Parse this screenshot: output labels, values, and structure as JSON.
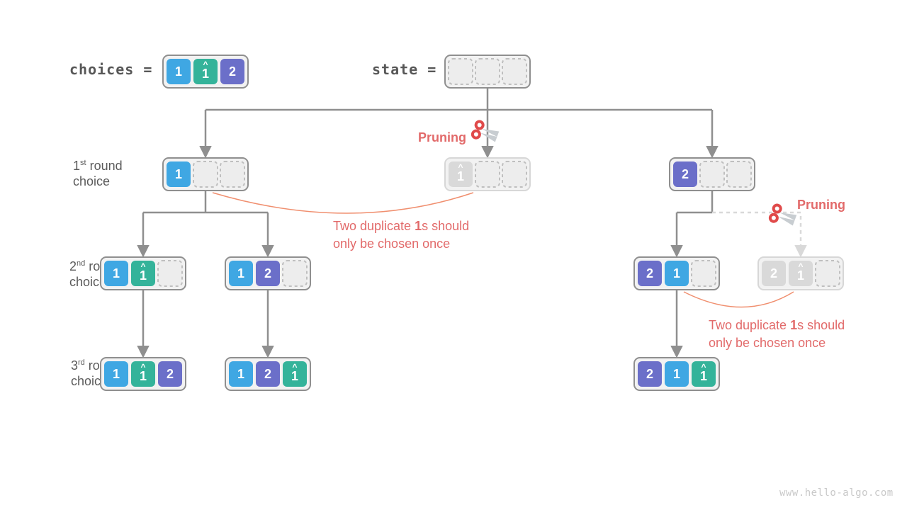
{
  "header": {
    "choices_label": "choices =",
    "state_label": "state ="
  },
  "rounds": {
    "r1_pre": "1",
    "r1_sup": "st",
    "r1_post": " round",
    "r2_pre": "2",
    "r2_sup": "nd",
    "r2_post": " round",
    "r3_pre": "3",
    "r3_sup": "rd",
    "r3_post": " round",
    "word_choice": "choice"
  },
  "values": {
    "one": "1",
    "onehat_caret": "^",
    "onehat": "1",
    "two": "2"
  },
  "annotations": {
    "pruning": "Pruning",
    "dup_line1": "Two duplicate ",
    "dup_bold": "1",
    "dup_line1b": "s should",
    "dup_line2": "only be chosen once"
  },
  "watermark": "www.hello-algo.com",
  "chart_data": {
    "type": "tree",
    "input_choices": [
      "1",
      "1̂",
      "2"
    ],
    "initial_state": [
      "_",
      "_",
      "_"
    ],
    "levels": [
      {
        "round": 1,
        "nodes": [
          {
            "state": [
              "1",
              "_",
              "_"
            ],
            "pruned": false
          },
          {
            "state": [
              "1̂",
              "_",
              "_"
            ],
            "pruned": true,
            "reason": "duplicate of 1"
          },
          {
            "state": [
              "2",
              "_",
              "_"
            ],
            "pruned": false
          }
        ]
      },
      {
        "round": 2,
        "nodes": [
          {
            "parent": 0,
            "state": [
              "1",
              "1̂",
              "_"
            ],
            "pruned": false
          },
          {
            "parent": 0,
            "state": [
              "1",
              "2",
              "_"
            ],
            "pruned": false
          },
          {
            "parent": 2,
            "state": [
              "2",
              "1",
              "_"
            ],
            "pruned": false
          },
          {
            "parent": 2,
            "state": [
              "2",
              "1̂",
              "_"
            ],
            "pruned": true,
            "reason": "duplicate of 1"
          }
        ]
      },
      {
        "round": 3,
        "nodes": [
          {
            "parent": 0,
            "state": [
              "1",
              "1̂",
              "2"
            ],
            "pruned": false
          },
          {
            "parent": 1,
            "state": [
              "1",
              "2",
              "1̂"
            ],
            "pruned": false
          },
          {
            "parent": 2,
            "state": [
              "2",
              "1",
              "1̂"
            ],
            "pruned": false
          }
        ]
      }
    ],
    "annotation": "Two duplicate 1s should only be chosen once"
  }
}
